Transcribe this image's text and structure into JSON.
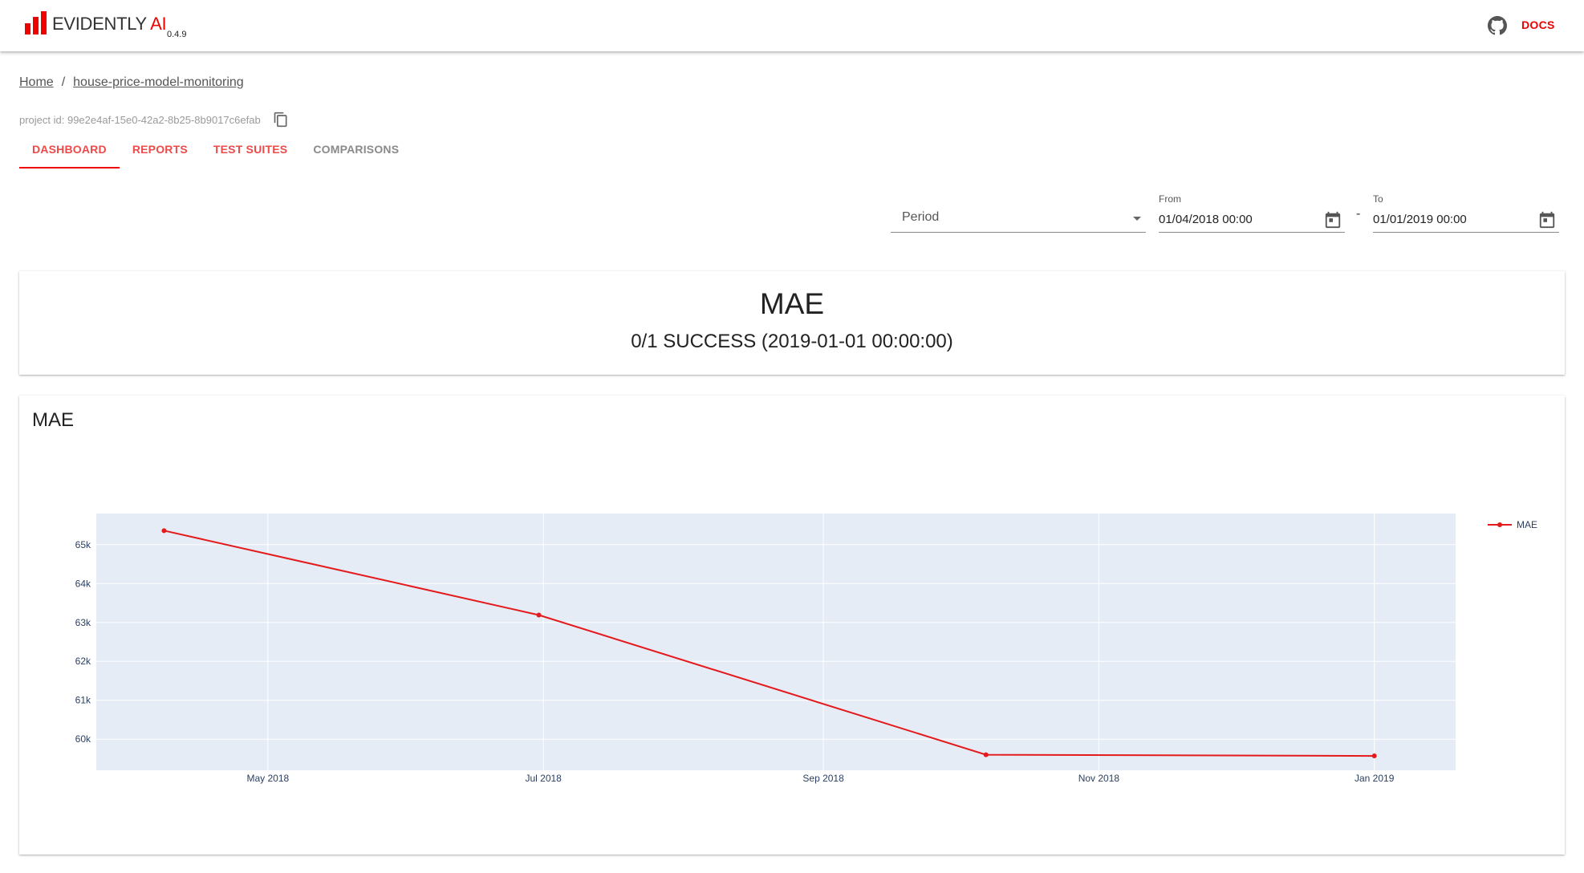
{
  "header": {
    "logo_text": "EVIDENTLY",
    "logo_ai": "AI",
    "version": "0.4.9",
    "github_icon": "github-icon",
    "docs_label": "DOCS",
    "accent_color": "#ed0400"
  },
  "breadcrumb": {
    "home": "Home",
    "separator": "/",
    "project": "house-price-model-monitoring"
  },
  "project_id": "project id: 99e2e4af-15e0-42a2-8b25-8b9017c6efab",
  "tabs": [
    {
      "label": "DASHBOARD",
      "active": true
    },
    {
      "label": "REPORTS",
      "active": false
    },
    {
      "label": "TEST SUITES",
      "active": false
    },
    {
      "label": "COMPARISONS",
      "active": false
    }
  ],
  "filters": {
    "period_label": "Period",
    "from_label": "From",
    "from_value": "01/04/2018 00:00",
    "separator": "-",
    "to_label": "To",
    "to_value": "01/01/2019 00:00"
  },
  "counter": {
    "title": "MAE",
    "value": "0/1 SUCCESS (2019-01-01 00:00:00)"
  },
  "plot_panel": {
    "title": "MAE"
  },
  "chart_data": {
    "type": "line",
    "title": "",
    "xlabel": "",
    "ylabel": "",
    "x": [
      "2018-04-08",
      "2018-06-30",
      "2018-10-07",
      "2019-01-01"
    ],
    "series": [
      {
        "name": "MAE",
        "color": "#e41a1c",
        "values": [
          65360,
          63190,
          59600,
          59570
        ]
      }
    ],
    "x_ticks": [
      "May 2018",
      "Jul 2018",
      "Sep 2018",
      "Nov 2018",
      "Jan 2019"
    ],
    "x_tick_dates": [
      "2018-05-01",
      "2018-07-01",
      "2018-09-01",
      "2018-11-01",
      "2019-01-01"
    ],
    "xlim": [
      "2018-03-24",
      "2019-01-19"
    ],
    "y_ticks": [
      "60k",
      "61k",
      "62k",
      "63k",
      "64k",
      "65k"
    ],
    "y_tick_values": [
      60000,
      61000,
      62000,
      63000,
      64000,
      65000
    ],
    "ylim": [
      59200,
      65800
    ],
    "grid": true,
    "legend": "top-right",
    "plot_bg": "#e5ecf6"
  }
}
